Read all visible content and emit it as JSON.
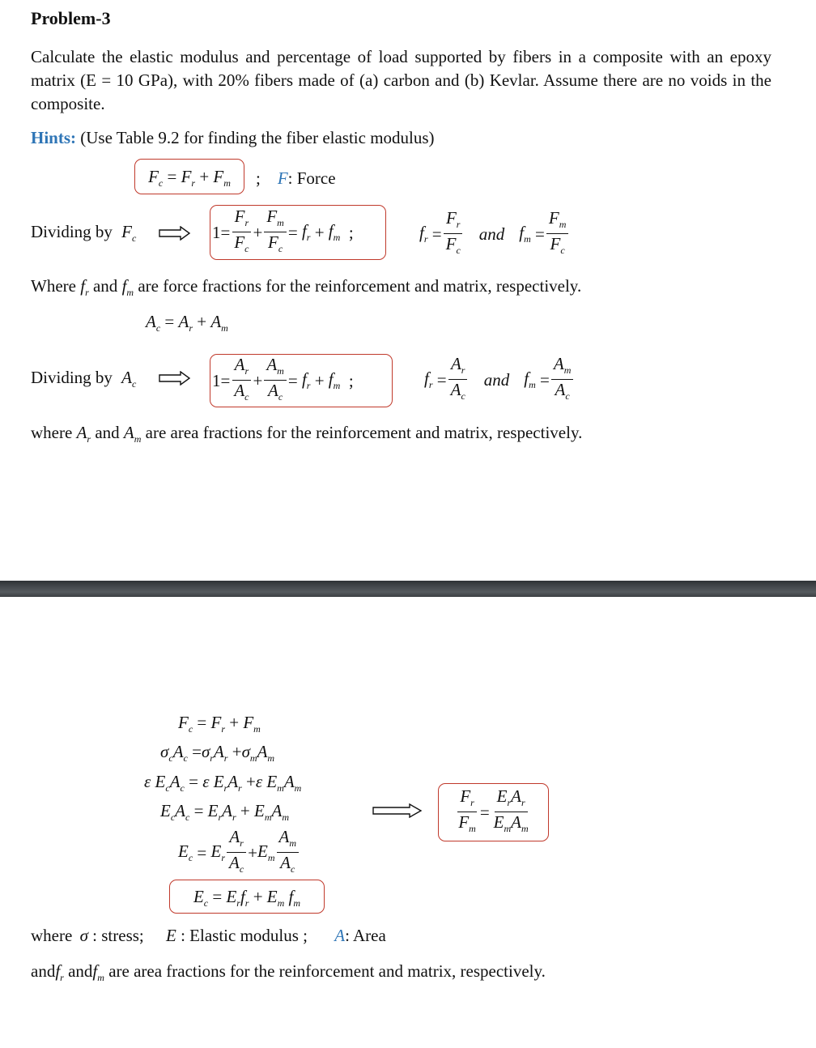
{
  "title": "Problem-3",
  "problem_text": "Calculate the elastic modulus and percentage of load supported by fibers in a composite with an epoxy matrix (E = 10 GPa), with 20% fibers made of (a) carbon and (b) Kevlar. Assume there are no voids in the composite.",
  "hints": {
    "label": "Hints:",
    "text": "(Use Table 9.2 for finding the fiber elastic modulus)"
  },
  "force_section": {
    "equation_left": "F",
    "sep": ";",
    "legend_symbol": "F",
    "legend_text": ": Force",
    "dividing_label": "Dividing by",
    "and_word": "and",
    "where_text_prefix": "Where",
    "where_text_mid": "and",
    "where_text_suffix": "are force fractions for the reinforcement and matrix, respectively."
  },
  "area_section": {
    "dividing_label": "Dividing by",
    "and_word": "and",
    "where_prefix": "where",
    "where_mid": "and",
    "where_suffix": "are area fractions for the reinforcement and matrix, respectively."
  },
  "derivation": {
    "legend": {
      "where": "where",
      "sigma_text": ": stress;",
      "e_text": ": Elastic modulus ;",
      "a_symbol": "A",
      "a_text": ": Area"
    },
    "footer_prefix": "and",
    "footer_mid": "and",
    "footer_suffix": "are area fractions for the reinforcement and matrix, respectively."
  },
  "colors": {
    "box_border": "#c0392b",
    "accent_blue": "#2e75b6",
    "separator": "#4a4e52"
  }
}
